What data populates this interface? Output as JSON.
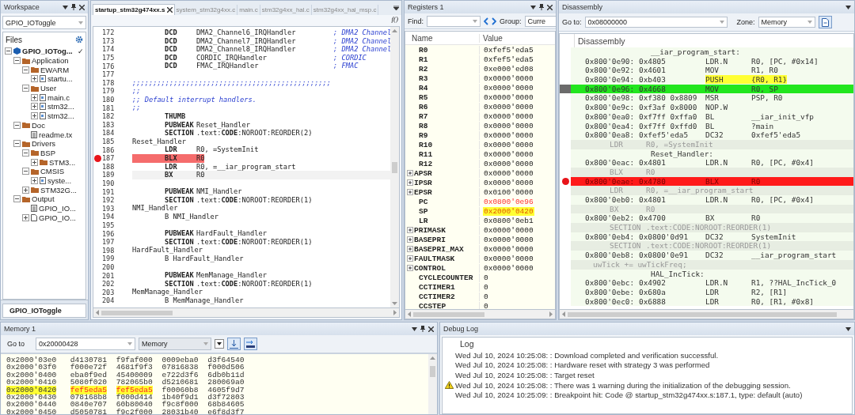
{
  "workspace": {
    "title": "Workspace",
    "project_select": "GPIO_IOToggle",
    "files_header": "Files",
    "tree": [
      {
        "label": "GPIO_IOTog...",
        "kind": "project",
        "expanded": true,
        "check": "✓",
        "children": [
          {
            "label": "Application",
            "kind": "folder",
            "expanded": true,
            "children": [
              {
                "label": "EWARM",
                "kind": "folder",
                "expanded": true,
                "children": [
                  {
                    "label": "startu...",
                    "kind": "file",
                    "expanded": false
                  }
                ]
              },
              {
                "label": "User",
                "kind": "folder",
                "expanded": true,
                "children": [
                  {
                    "label": "main.c",
                    "kind": "file",
                    "expanded": false
                  },
                  {
                    "label": "stm32...",
                    "kind": "file",
                    "expanded": false
                  },
                  {
                    "label": "stm32...",
                    "kind": "file",
                    "expanded": false
                  }
                ]
              }
            ]
          },
          {
            "label": "Doc",
            "kind": "folder",
            "expanded": true,
            "children": [
              {
                "label": "readme.tx",
                "kind": "doc"
              }
            ]
          },
          {
            "label": "Drivers",
            "kind": "folder",
            "expanded": true,
            "children": [
              {
                "label": "BSP",
                "kind": "folder",
                "expanded": true,
                "children": [
                  {
                    "label": "STM3...",
                    "kind": "folder",
                    "expanded": false
                  }
                ]
              },
              {
                "label": "CMSIS",
                "kind": "folder",
                "expanded": true,
                "children": [
                  {
                    "label": "syste...",
                    "kind": "file",
                    "expanded": false
                  }
                ]
              },
              {
                "label": "STM32G...",
                "kind": "folder",
                "expanded": false
              }
            ]
          },
          {
            "label": "Output",
            "kind": "folder",
            "expanded": true,
            "children": [
              {
                "label": "GPIO_IO...",
                "kind": "doc"
              },
              {
                "label": "GPIO_IO...",
                "kind": "page",
                "expanded": false
              }
            ]
          }
        ]
      }
    ],
    "tab": "GPIO_IOToggle"
  },
  "editor": {
    "tabs": [
      {
        "label": "startup_stm32g474xx.s",
        "selected": true
      },
      {
        "label": "system_stm32g4xx.c",
        "selected": false
      },
      {
        "label": "main.c",
        "selected": false
      },
      {
        "label": "stm32g4xx_hal.c",
        "selected": false
      },
      {
        "label": "stm32g4xx_hal_msp.c",
        "selected": false
      }
    ],
    "function_button": "f()",
    "lines": [
      {
        "number": "172",
        "kind": "instr",
        "op": "DCD",
        "args": "DMA2_Channel6_IRQHandler",
        "comment": "; DMA2 Channel",
        "breakpoint": false,
        "current": false
      },
      {
        "number": "173",
        "kind": "instr",
        "op": "DCD",
        "args": "DMA2_Channel7_IRQHandler",
        "comment": "; DMA2 Channel",
        "breakpoint": false,
        "current": false
      },
      {
        "number": "174",
        "kind": "instr",
        "op": "DCD",
        "args": "DMA2_Channel8_IRQHandler",
        "comment": "; DMA2 Channel",
        "breakpoint": false,
        "current": false
      },
      {
        "number": "175",
        "kind": "instr",
        "op": "DCD",
        "args": "CORDIC_IRQHandler",
        "comment": "; CORDIC",
        "breakpoint": false,
        "current": false
      },
      {
        "number": "176",
        "kind": "instr",
        "op": "DCD",
        "args": "FMAC_IRQHandler",
        "comment": "; FMAC",
        "breakpoint": false,
        "current": false
      },
      {
        "number": "177",
        "kind": "blank",
        "breakpoint": false,
        "current": false
      },
      {
        "number": "178",
        "kind": "comment",
        "text": ";;;;;;;;;;;;;;;;;;;;;;;;;;;;;;;;;;;;;;;;;;;;;;;;",
        "breakpoint": false,
        "current": false
      },
      {
        "number": "179",
        "kind": "comment",
        "text": ";;",
        "breakpoint": false,
        "current": false
      },
      {
        "number": "180",
        "kind": "comment",
        "text": ";; Default interrupt handlers.",
        "breakpoint": false,
        "current": false
      },
      {
        "number": "181",
        "kind": "comment",
        "text": ";;",
        "breakpoint": false,
        "current": false
      },
      {
        "number": "182",
        "kind": "instr",
        "op": "THUMB",
        "breakpoint": false,
        "current": false
      },
      {
        "number": "183",
        "kind": "instr",
        "op": "PUBWEAK",
        "args": "Reset_Handler",
        "breakpoint": false,
        "current": false
      },
      {
        "number": "184",
        "kind": "instr",
        "op": "SECTION",
        "args": ".text:**CODE**:NOROOT:REORDER(2)",
        "breakpoint": false,
        "current": false
      },
      {
        "number": "185",
        "kind": "label",
        "text": "Reset_Handler",
        "breakpoint": false,
        "current": false
      },
      {
        "number": "186",
        "kind": "instr",
        "op": "LDR",
        "args": "R0, =SystemInit",
        "breakpoint": false,
        "current": false
      },
      {
        "number": "187",
        "kind": "instr",
        "op": "BLX",
        "args": "R0",
        "breakpoint": true,
        "current": false
      },
      {
        "number": "188",
        "kind": "instr",
        "op": "LDR",
        "args": "R0, =__iar_program_start",
        "breakpoint": false,
        "current": false
      },
      {
        "number": "189",
        "kind": "instr",
        "op": "BX",
        "args": "R0",
        "breakpoint": false,
        "current": true
      },
      {
        "number": "190",
        "kind": "blank",
        "breakpoint": false,
        "current": false
      },
      {
        "number": "191",
        "kind": "instr",
        "op": "PUBWEAK",
        "args": "NMI_Handler",
        "breakpoint": false,
        "current": false
      },
      {
        "number": "192",
        "kind": "instr",
        "op": "SECTION",
        "args": ".text:**CODE**:NOROOT:REORDER(1)",
        "breakpoint": false,
        "current": false
      },
      {
        "number": "193",
        "kind": "label",
        "text": "NMI_Handler",
        "breakpoint": false,
        "current": false
      },
      {
        "number": "194",
        "kind": "plain",
        "text": "B NMI_Handler",
        "breakpoint": false,
        "current": false
      },
      {
        "number": "195",
        "kind": "blank",
        "breakpoint": false,
        "current": false
      },
      {
        "number": "196",
        "kind": "instr",
        "op": "PUBWEAK",
        "args": "HardFault_Handler",
        "breakpoint": false,
        "current": false
      },
      {
        "number": "197",
        "kind": "instr",
        "op": "SECTION",
        "args": ".text:**CODE**:NOROOT:REORDER(1)",
        "breakpoint": false,
        "current": false
      },
      {
        "number": "198",
        "kind": "label",
        "text": "HardFault_Handler",
        "breakpoint": false,
        "current": false
      },
      {
        "number": "199",
        "kind": "plain",
        "text": "B HardFault_Handler",
        "breakpoint": false,
        "current": false
      },
      {
        "number": "200",
        "kind": "blank",
        "breakpoint": false,
        "current": false
      },
      {
        "number": "201",
        "kind": "instr",
        "op": "PUBWEAK",
        "args": "MemManage_Handler",
        "breakpoint": false,
        "current": false
      },
      {
        "number": "202",
        "kind": "instr",
        "op": "SECTION",
        "args": ".text:**CODE**:NOROOT:REORDER(1)",
        "breakpoint": false,
        "current": false
      },
      {
        "number": "203",
        "kind": "label",
        "text": "MemManage_Handler",
        "breakpoint": false,
        "current": false
      },
      {
        "number": "204",
        "kind": "plain",
        "text": "B MemManage_Handler",
        "breakpoint": false,
        "current": false
      }
    ]
  },
  "registers": {
    "title": "Registers 1",
    "find_label": "Find:",
    "group_label": "Group:",
    "group_value": "Curre",
    "columns": [
      "Name",
      "Value"
    ],
    "rows": [
      {
        "name": "R0",
        "value": "0xfef5'eda5",
        "expandable": false,
        "changed": false,
        "highlighted": false
      },
      {
        "name": "R1",
        "value": "0xfef5'eda5",
        "expandable": false,
        "changed": false,
        "highlighted": false
      },
      {
        "name": "R2",
        "value": "0xe000'ed08",
        "expandable": false,
        "changed": false,
        "highlighted": false
      },
      {
        "name": "R3",
        "value": "0x0000'0000",
        "expandable": false,
        "changed": false,
        "highlighted": false
      },
      {
        "name": "R4",
        "value": "0x0000'0000",
        "expandable": false,
        "changed": false,
        "highlighted": false
      },
      {
        "name": "R5",
        "value": "0x0000'0000",
        "expandable": false,
        "changed": false,
        "highlighted": false
      },
      {
        "name": "R6",
        "value": "0x0000'0000",
        "expandable": false,
        "changed": false,
        "highlighted": false
      },
      {
        "name": "R7",
        "value": "0x0000'0000",
        "expandable": false,
        "changed": false,
        "highlighted": false
      },
      {
        "name": "R8",
        "value": "0x0000'0000",
        "expandable": false,
        "changed": false,
        "highlighted": false
      },
      {
        "name": "R9",
        "value": "0x0000'0000",
        "expandable": false,
        "changed": false,
        "highlighted": false
      },
      {
        "name": "R10",
        "value": "0x0000'0000",
        "expandable": false,
        "changed": false,
        "highlighted": false
      },
      {
        "name": "R11",
        "value": "0x0000'0000",
        "expandable": false,
        "changed": false,
        "highlighted": false
      },
      {
        "name": "R12",
        "value": "0x0000'0000",
        "expandable": false,
        "changed": false,
        "highlighted": false
      },
      {
        "name": "APSR",
        "value": "0x0000'0000",
        "expandable": true,
        "changed": false,
        "highlighted": false
      },
      {
        "name": "IPSR",
        "value": "0x0000'0000",
        "expandable": true,
        "changed": false,
        "highlighted": false
      },
      {
        "name": "EPSR",
        "value": "0x0100'0000",
        "expandable": true,
        "changed": false,
        "highlighted": false
      },
      {
        "name": "PC",
        "value": "0x0800'0e96",
        "expandable": false,
        "changed": true,
        "highlighted": false
      },
      {
        "name": "SP",
        "value": "0x2000'0420",
        "expandable": false,
        "changed": true,
        "highlighted": true
      },
      {
        "name": "LR",
        "value": "0x0800'0eb1",
        "expandable": false,
        "changed": false,
        "highlighted": false
      },
      {
        "name": "PRIMASK",
        "value": "0x0000'0000",
        "expandable": true,
        "changed": false,
        "highlighted": false
      },
      {
        "name": "BASEPRI",
        "value": "0x0000'0000",
        "expandable": true,
        "changed": false,
        "highlighted": false
      },
      {
        "name": "BASEPRI_MAX",
        "value": "0x0000'0000",
        "expandable": true,
        "changed": false,
        "highlighted": false
      },
      {
        "name": "FAULTMASK",
        "value": "0x0000'0000",
        "expandable": true,
        "changed": false,
        "highlighted": false
      },
      {
        "name": "CONTROL",
        "value": "0x0000'0000",
        "expandable": true,
        "changed": false,
        "highlighted": false
      },
      {
        "name": "CYCLECOUNTER",
        "value": "0",
        "expandable": false,
        "changed": false,
        "highlighted": false
      },
      {
        "name": "CCTIMER1",
        "value": "0",
        "expandable": false,
        "changed": false,
        "highlighted": false
      },
      {
        "name": "CCTIMER2",
        "value": "0",
        "expandable": false,
        "changed": false,
        "highlighted": false
      },
      {
        "name": "CCSTEP",
        "value": "0",
        "expandable": false,
        "changed": false,
        "highlighted": false
      }
    ]
  },
  "disassembly": {
    "title": "Disassembly",
    "goto_label": "Go to:",
    "goto_value": "0x08000000",
    "zone_label": "Zone:",
    "zone_value": "Memory",
    "header": "Disassembly",
    "rows": [
      {
        "kind": "label",
        "text": "__iar_program_start:"
      },
      {
        "kind": "instr",
        "address": "0x800'0e90:",
        "code": "0x4805",
        "op": "LDR.N",
        "args": "R0, [PC, #0x14]",
        "marked": false,
        "current": false,
        "breakpoint": false
      },
      {
        "kind": "instr",
        "address": "0x800'0e92:",
        "code": "0x4601",
        "op": "MOV",
        "args": "R1, R0",
        "marked": false,
        "current": false,
        "breakpoint": false
      },
      {
        "kind": "instr",
        "address": "0x800'0e94:",
        "code": "0xb403",
        "op": "PUSH",
        "args": "{R0, R1}",
        "marked": true,
        "current": false,
        "breakpoint": false
      },
      {
        "kind": "instr",
        "address": "0x800'0e96:",
        "code": "0x4668",
        "op": "MOV",
        "args": "R0, SP",
        "marked": false,
        "current": true,
        "breakpoint": false
      },
      {
        "kind": "instr",
        "address": "0x800'0e98:",
        "code": "0xf380 0x8809",
        "op": "MSR",
        "args": "PSP, R0",
        "marked": false,
        "current": false,
        "breakpoint": false
      },
      {
        "kind": "instr",
        "address": "0x800'0e9c:",
        "code": "0xf3af 0x8000",
        "op": "NOP.W",
        "args": "",
        "marked": false,
        "current": false,
        "breakpoint": false
      },
      {
        "kind": "instr",
        "address": "0x800'0ea0:",
        "code": "0xf7ff 0xffa0",
        "op": "BL",
        "args": "__iar_init_vfp",
        "marked": false,
        "current": false,
        "breakpoint": false
      },
      {
        "kind": "instr",
        "address": "0x800'0ea4:",
        "code": "0xf7ff 0xffd0",
        "op": "BL",
        "args": "?main",
        "marked": false,
        "current": false,
        "breakpoint": false
      },
      {
        "kind": "instr",
        "address": "0x800'0ea8:",
        "code": "0xfef5'eda5",
        "op": "DC32",
        "args": "0xfef5'eda5",
        "marked": false,
        "current": false,
        "breakpoint": false
      },
      {
        "kind": "asm_source",
        "op": "LDR",
        "args": "R0, =SystemInit"
      },
      {
        "kind": "label",
        "text": "Reset_Handler:"
      },
      {
        "kind": "instr",
        "address": "0x800'0eac:",
        "code": "0x4801",
        "op": "LDR.N",
        "args": "R0, [PC, #0x4]",
        "marked": false,
        "current": false,
        "breakpoint": false
      },
      {
        "kind": "asm_source",
        "op": "BLX",
        "args": "R0"
      },
      {
        "kind": "instr",
        "address": "0x800'0eae:",
        "code": "0x4780",
        "op": "BLX",
        "args": "R0",
        "marked": false,
        "current": false,
        "breakpoint": true
      },
      {
        "kind": "asm_source",
        "op": "LDR",
        "args": "R0, =__iar_program_start"
      },
      {
        "kind": "instr",
        "address": "0x800'0eb0:",
        "code": "0x4801",
        "op": "LDR.N",
        "args": "R0, [PC, #0x4]",
        "marked": false,
        "current": false,
        "breakpoint": false
      },
      {
        "kind": "asm_source",
        "op": "BX",
        "args": "R0"
      },
      {
        "kind": "instr",
        "address": "0x800'0eb2:",
        "code": "0x4700",
        "op": "BX",
        "args": "R0",
        "marked": false,
        "current": false,
        "breakpoint": false
      },
      {
        "kind": "asm_source",
        "op": "SECTION",
        "args": ".text:CODE:NOROOT:REORDER(1)"
      },
      {
        "kind": "instr",
        "address": "0x800'0eb4:",
        "code": "0x0800'0d91",
        "op": "DC32",
        "args": "SystemInit",
        "marked": false,
        "current": false,
        "breakpoint": false
      },
      {
        "kind": "asm_source",
        "op": "SECTION",
        "args": ".text:CODE:NOROOT:REORDER(1)"
      },
      {
        "kind": "instr",
        "address": "0x800'0eb8:",
        "code": "0x0800'0e91",
        "op": "DC32",
        "args": "__iar_program_start",
        "marked": false,
        "current": false,
        "breakpoint": false
      },
      {
        "kind": "c_source",
        "text": "uwTick += uwTickFreq;"
      },
      {
        "kind": "label",
        "text": "HAL_IncTick:"
      },
      {
        "kind": "instr",
        "address": "0x800'0ebc:",
        "code": "0x4902",
        "op": "LDR.N",
        "args": "R1, ??HAL_IncTick_0",
        "marked": false,
        "current": false,
        "breakpoint": false
      },
      {
        "kind": "instr",
        "address": "0x800'0ebe:",
        "code": "0x680a",
        "op": "LDR",
        "args": "R2, [R1]",
        "marked": false,
        "current": false,
        "breakpoint": false
      },
      {
        "kind": "instr",
        "address": "0x800'0ec0:",
        "code": "0x6888",
        "op": "LDR",
        "args": "R0, [R1, #0x8]",
        "marked": false,
        "current": false,
        "breakpoint": false
      }
    ]
  },
  "memory": {
    "title": "Memory 1",
    "goto_label": "Go to",
    "goto_value": "0x20000428",
    "zone_value": "Memory",
    "rows": [
      {
        "address": "0x2000'03e0",
        "highlighted": false,
        "words": [
          {
            "value": "d4130781",
            "changed": false
          },
          {
            "value": "f9faf000",
            "changed": false
          },
          {
            "value": "0009eba0",
            "changed": false
          },
          {
            "value": "d3f64540",
            "changed": false
          }
        ]
      },
      {
        "address": "0x2000'03f0",
        "highlighted": false,
        "words": [
          {
            "value": "f000e72f",
            "changed": false
          },
          {
            "value": "4681f9f3",
            "changed": false
          },
          {
            "value": "07816838",
            "changed": false
          },
          {
            "value": "f000d506",
            "changed": false
          }
        ]
      },
      {
        "address": "0x2000'0400",
        "highlighted": false,
        "words": [
          {
            "value": "eba0f9ed",
            "changed": false
          },
          {
            "value": "45400009",
            "changed": false
          },
          {
            "value": "e722d3f6",
            "changed": false
          },
          {
            "value": "6db0b11d",
            "changed": false
          }
        ]
      },
      {
        "address": "0x2000'0410",
        "highlighted": false,
        "words": [
          {
            "value": "5080f020",
            "changed": false
          },
          {
            "value": "782065b0",
            "changed": false
          },
          {
            "value": "d5210681",
            "changed": false
          },
          {
            "value": "280069a0",
            "changed": false
          }
        ]
      },
      {
        "address": "0x2000'0420",
        "highlighted": true,
        "words": [
          {
            "value": "fef5eda5",
            "changed": true
          },
          {
            "value": "fef5eda5",
            "changed": true
          },
          {
            "value": "f00060b8",
            "changed": false
          },
          {
            "value": "4605f9d7",
            "changed": false
          }
        ]
      },
      {
        "address": "0x2000'0430",
        "highlighted": false,
        "words": [
          {
            "value": "078168b8",
            "changed": false
          },
          {
            "value": "f000d414",
            "changed": false
          },
          {
            "value": "1b40f9d1",
            "changed": false
          },
          {
            "value": "d3f72803",
            "changed": false
          }
        ]
      },
      {
        "address": "0x2000'0440",
        "highlighted": false,
        "words": [
          {
            "value": "0840e707",
            "changed": false
          },
          {
            "value": "60b80040",
            "changed": false
          },
          {
            "value": "f9c8f000",
            "changed": false
          },
          {
            "value": "68b84605",
            "changed": false
          }
        ]
      },
      {
        "address": "0x2000'0450",
        "highlighted": false,
        "words": [
          {
            "value": "d5050781",
            "changed": false
          },
          {
            "value": "f9c2f000",
            "changed": false
          },
          {
            "value": "28031b40",
            "changed": false
          },
          {
            "value": "e6f8d3f7",
            "changed": false
          }
        ]
      }
    ]
  },
  "debug_log": {
    "title": "Debug Log",
    "header": "Log",
    "entries": [
      {
        "kind": "info",
        "text": "Wed Jul 10, 2024 10:25:08: : Download completed and verification successful."
      },
      {
        "kind": "info",
        "text": "Wed Jul 10, 2024 10:25:08: : Hardware reset with strategy 3 was performed"
      },
      {
        "kind": "info",
        "text": "Wed Jul 10, 2024 10:25:08: : Target reset"
      },
      {
        "kind": "warning",
        "text": "Wed Jul 10, 2024 10:25:08: : There was 1 warning during the initialization of the debugging session."
      },
      {
        "kind": "info",
        "text": "Wed Jul 10, 2024 10:25:09: : Breakpoint hit: Code @ startup_stm32g474xx.s:187.1, type: default (auto)"
      }
    ]
  }
}
